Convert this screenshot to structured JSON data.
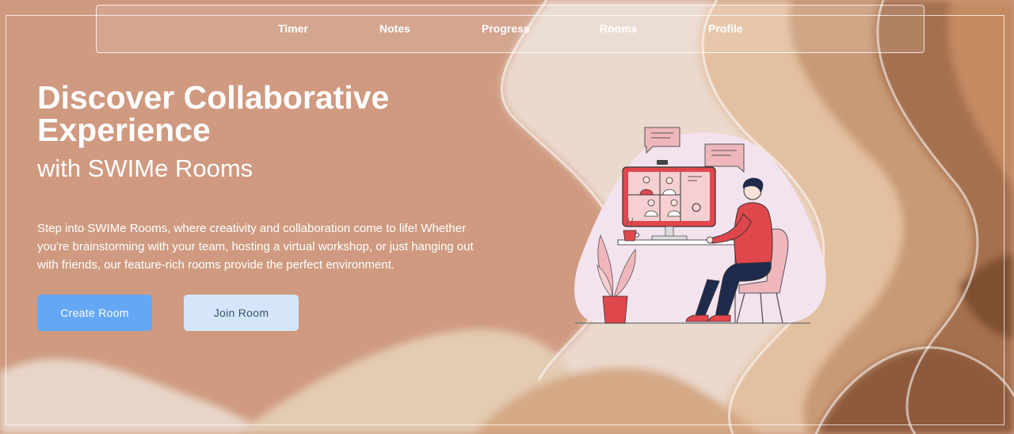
{
  "nav": {
    "items": [
      {
        "label": "Timer"
      },
      {
        "label": "Notes"
      },
      {
        "label": "Progress"
      },
      {
        "label": "Rooms"
      },
      {
        "label": "Profile"
      }
    ]
  },
  "hero": {
    "title": "Discover Collaborative Experience",
    "subtitle": "with SWIMe Rooms",
    "description": "Step into SWIMe Rooms, where creativity and collaboration come to life! Whether you're brainstorming with your team, hosting a virtual workshop, or just hanging out with friends, our feature-rich rooms provide the perfect environment."
  },
  "actions": {
    "create_label": "Create Room",
    "join_label": "Join Room"
  },
  "colors": {
    "primary_button": "#64a7f5",
    "secondary_button": "#d5e6fb",
    "background": "#cf9a80",
    "illustration_accent": "#e0474c"
  },
  "illustration": {
    "icon": "video-conference-illustration"
  }
}
